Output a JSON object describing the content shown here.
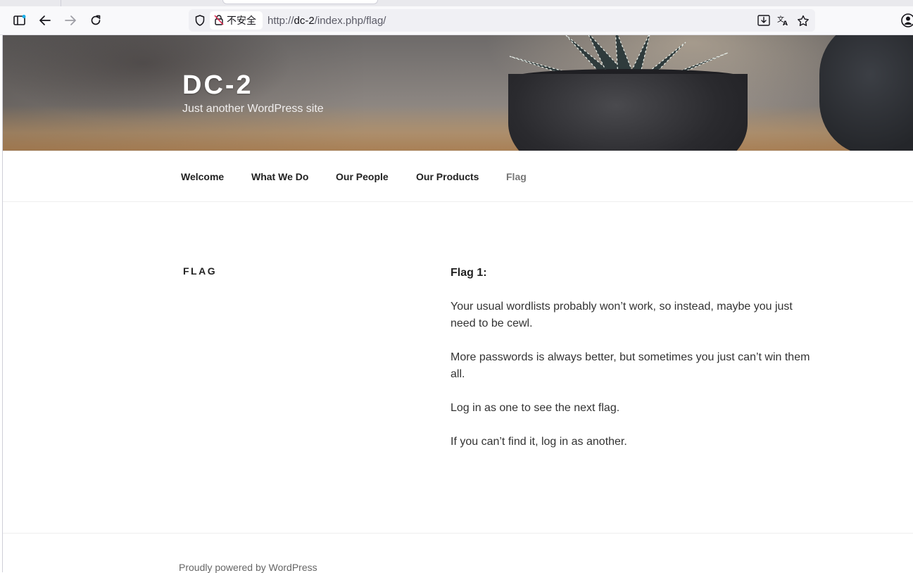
{
  "browser": {
    "security_label": "不安全",
    "url_prefix": "http://",
    "url_host": "dc-2",
    "url_path": "/index.php/flag/",
    "icons": {
      "sidebar": "sidebar-icon",
      "back": "back-arrow-icon",
      "forward": "forward-arrow-icon",
      "reload": "reload-icon",
      "shield": "tracking-protection-shield-icon",
      "insecure": "insecure-lock-icon",
      "download": "save-to-pocket-icon",
      "translate": "translate-icon",
      "bookmark": "bookmark-star-icon",
      "account": "account-icon"
    },
    "accent_color": "#1ab0ea"
  },
  "site": {
    "title": "DC-2",
    "description": "Just another WordPress site"
  },
  "nav": {
    "items": [
      {
        "label": "Welcome"
      },
      {
        "label": "What We Do"
      },
      {
        "label": "Our People"
      },
      {
        "label": "Our Products"
      },
      {
        "label": "Flag",
        "current": true
      }
    ]
  },
  "page": {
    "title": "FLAG",
    "paragraphs": [
      "Flag 1:",
      "Your usual wordlists probably won’t work, so instead, maybe you just need to be cewl.",
      "More passwords is always better, but sometimes you just can’t win them all.",
      "Log in as one to see the next flag.",
      "If you can’t find it, log in as another."
    ]
  },
  "footer": {
    "credit": "Proudly powered by WordPress"
  }
}
